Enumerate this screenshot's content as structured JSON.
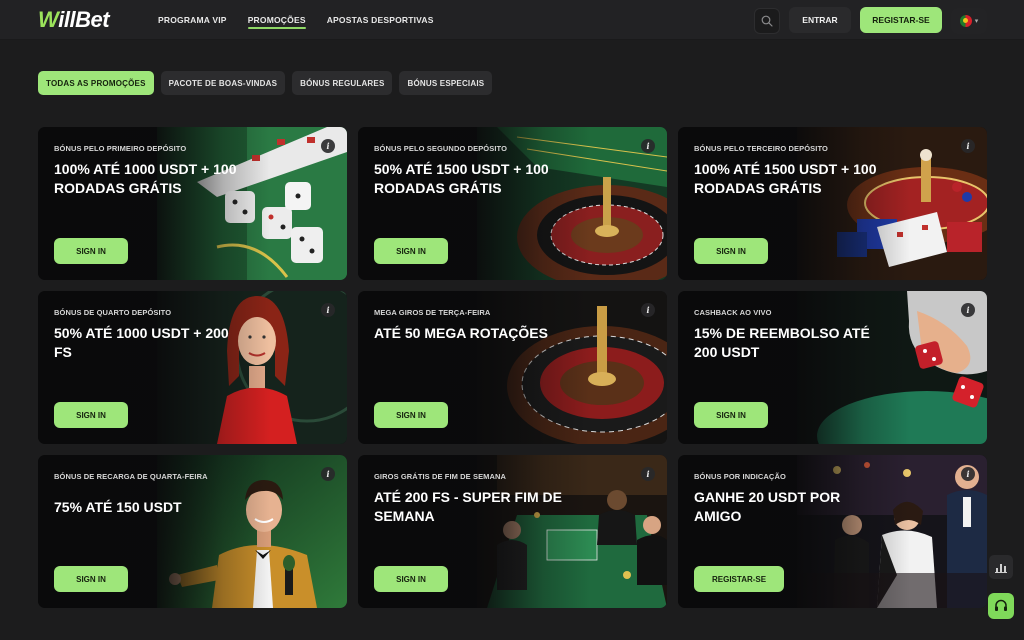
{
  "header": {
    "logo": {
      "first": "W",
      "rest": "illBet"
    },
    "nav": [
      "PROGRAMA VIP",
      "PROMOÇÕES",
      "APOSTAS DESPORTIVAS"
    ],
    "active_nav": "PROMOÇÕES",
    "login_label": "ENTRAR",
    "register_label": "REGISTAR-SE",
    "language": "Portugal"
  },
  "filters": [
    "TODAS AS PROMOÇÕES",
    "PACOTE DE BOAS-VINDAS",
    "BÓNUS REGULARES",
    "BÓNUS ESPECIAIS"
  ],
  "active_filter": "TODAS AS PROMOÇÕES",
  "cards": [
    {
      "label": "BÓNUS PELO PRIMEIRO DEPÓSITO",
      "title": "100% ATÉ 1000 USDT + 100 RODADAS GRÁTIS",
      "cta": "SIGN IN",
      "art": "dice-cards-icon"
    },
    {
      "label": "BÓNUS PELO SEGUNDO DEPÓSITO",
      "title": "50% ATÉ 1500 USDT + 100 RODADAS GRÁTIS",
      "cta": "SIGN IN",
      "art": "roulette-icon"
    },
    {
      "label": "BÓNUS PELO TERCEIRO DEPÓSITO",
      "title": "100% ATÉ 1500 USDT + 100 RODADAS GRÁTIS",
      "cta": "SIGN IN",
      "art": "roulette-chips-icon"
    },
    {
      "label": "BÓNUS DE QUARTO DEPÓSITO",
      "title": "50% ATÉ 1000 USDT + 200 FS",
      "cta": "SIGN IN",
      "art": "dealer-woman-icon"
    },
    {
      "label": "MEGA GIROS DE TERÇA-FEIRA",
      "title": "ATÉ 50 MEGA ROTAÇÕES",
      "cta": "SIGN IN",
      "art": "roulette-wheel-icon"
    },
    {
      "label": "CASHBACK AO VIVO",
      "title": "15% DE REEMBOLSO ATÉ 200 USDT",
      "cta": "SIGN IN",
      "art": "hand-dice-icon"
    },
    {
      "label": "BÓNUS DE RECARGA DE QUARTA-FEIRA",
      "title": "75% ATÉ 150 USDT",
      "cta": "SIGN IN",
      "art": "host-man-icon"
    },
    {
      "label": "GIROS GRÁTIS DE FIM DE SEMANA",
      "title": "ATÉ 200 FS - SUPER FIM DE SEMANA",
      "cta": "SIGN IN",
      "art": "casino-table-icon"
    },
    {
      "label": "BÓNUS POR INDICAÇÃO",
      "title": "GANHE 20 USDT POR AMIGO",
      "cta": "REGISTAR-SE",
      "art": "players-group-icon"
    }
  ],
  "info_glyph": "i",
  "colors": {
    "accent": "#9ee67a",
    "background": "#1c1c1d",
    "header": "#222224",
    "card": "#0e0f10"
  }
}
